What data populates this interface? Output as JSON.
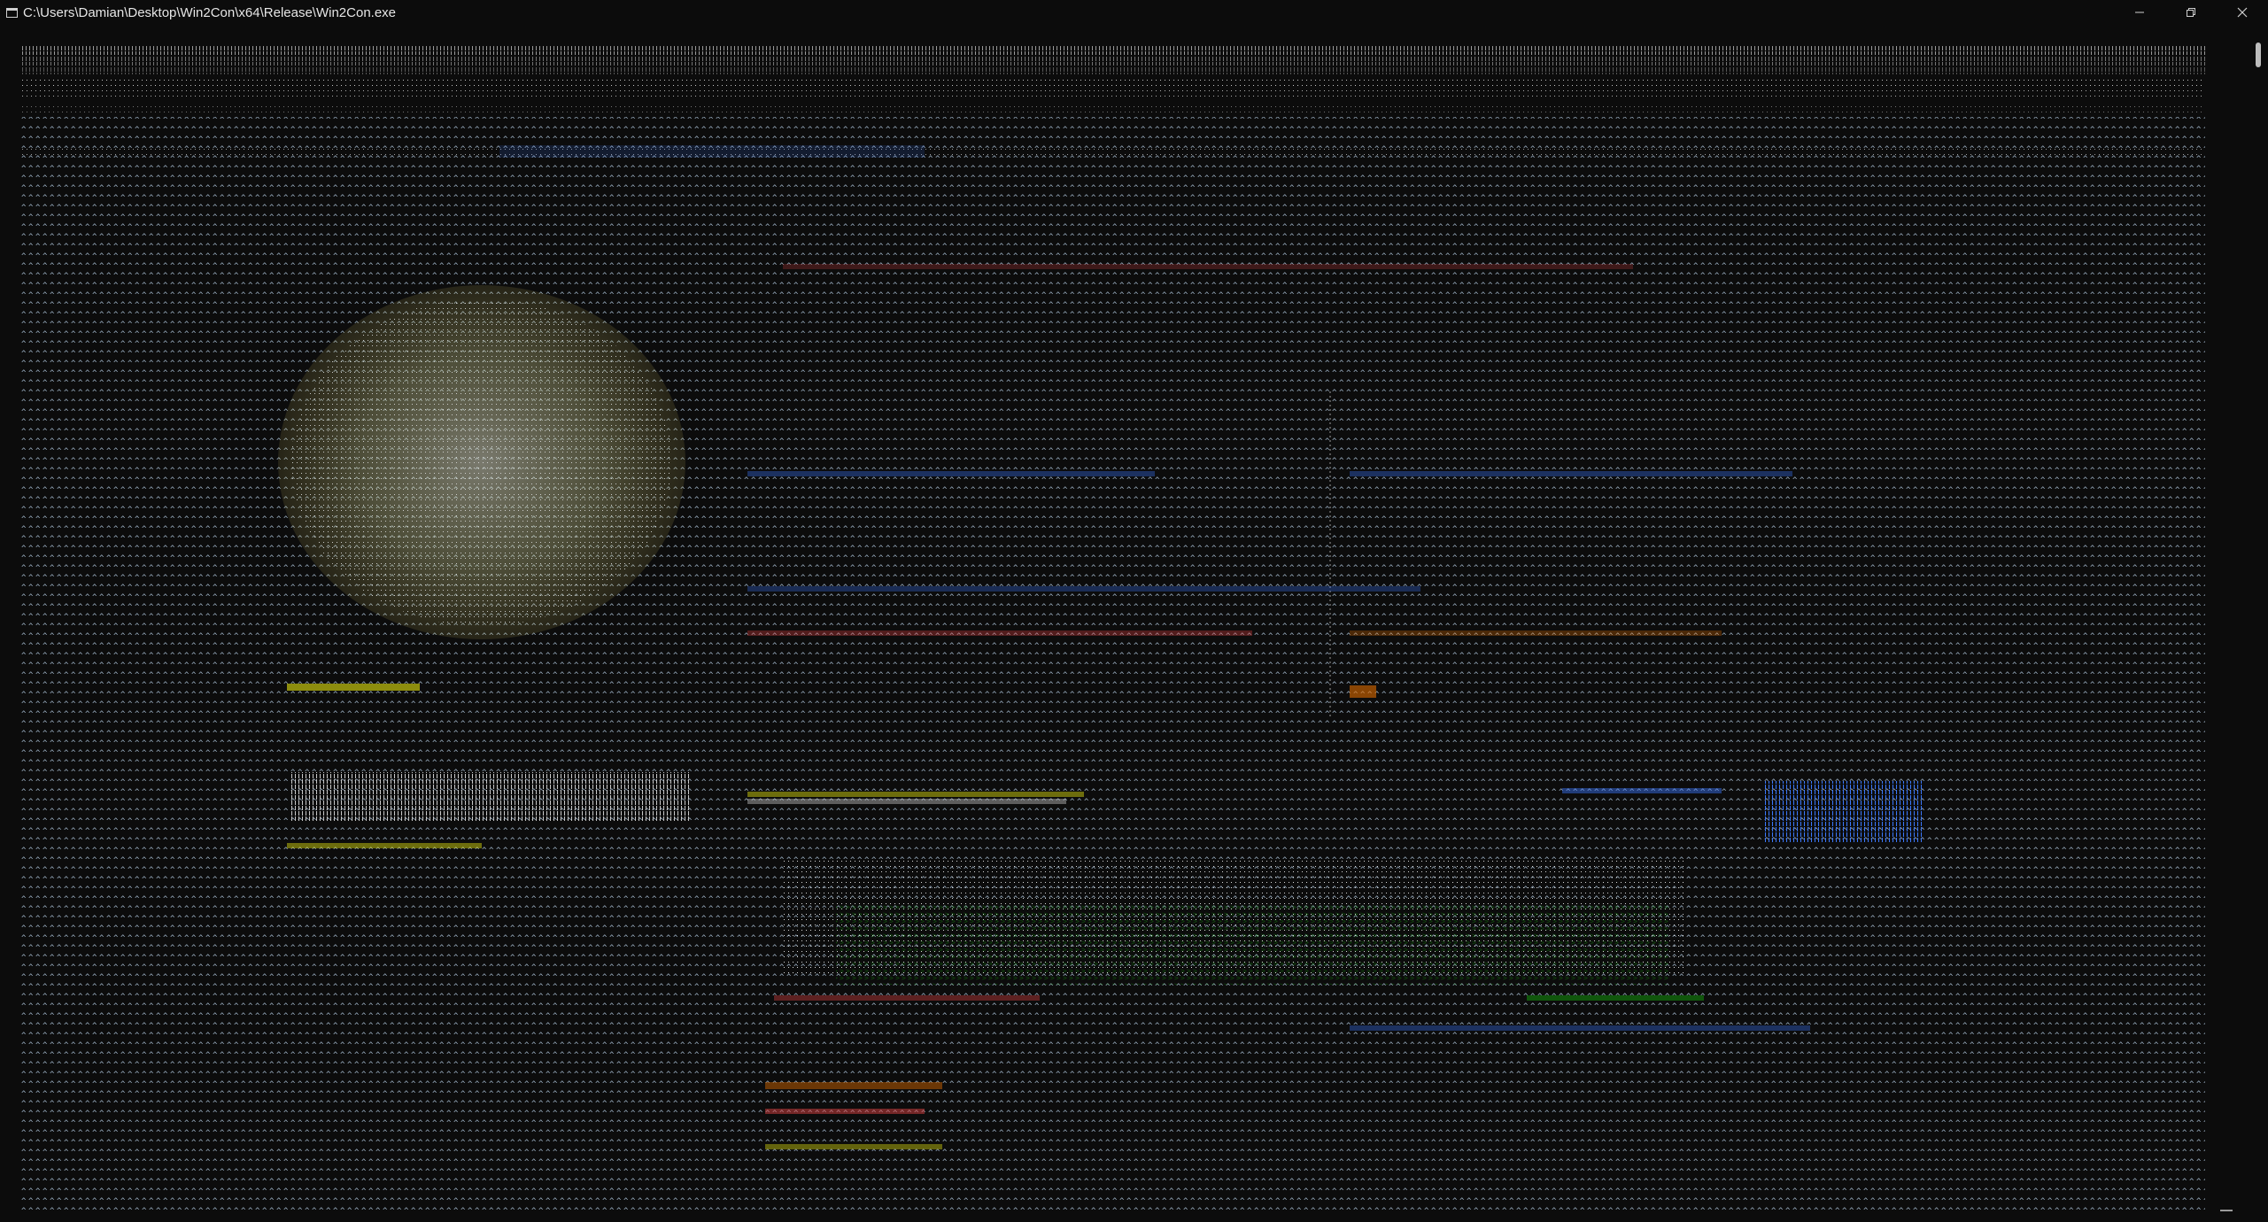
{
  "window": {
    "title": "C:\\Users\\Damian\\Desktop\\Win2Con\\x64\\Release\\Win2Con.exe",
    "icon": "console-app-icon",
    "controls": [
      "minimize-icon",
      "restore-icon",
      "close-icon"
    ]
  },
  "console": {
    "background": "#0c0c0c",
    "fill_glyph": "^",
    "fill_color": "#9fb4c8",
    "accent_colors": [
      "#3b78ff",
      "#e5e510",
      "#e06c00",
      "#16c60c",
      "#d94040",
      "#c0c0c0",
      "#ffffff"
    ]
  }
}
